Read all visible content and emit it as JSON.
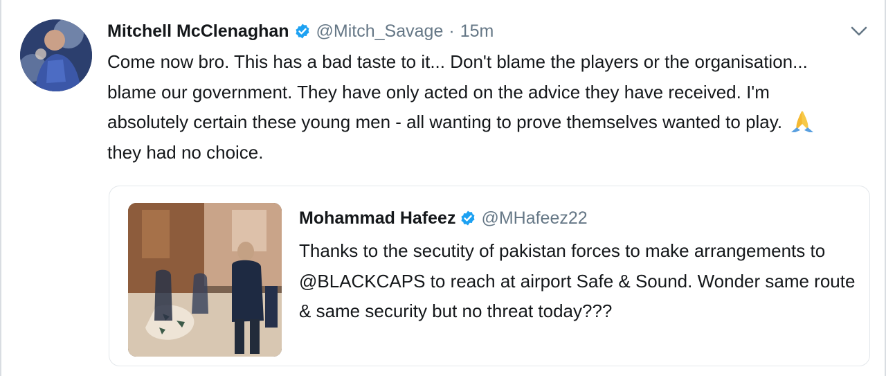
{
  "tweet": {
    "author_name": "Mitchell McClenaghan",
    "author_handle": "@Mitch_Savage",
    "separator": "·",
    "timestamp": "15m",
    "text_before_emoji": "Come now bro. This has a bad taste to it... Don't blame the players or the organisation... blame our government. They have only acted on the advice they have received. I'm absolutely certain these young men - all wanting to prove themselves  wanted to play.",
    "emoji_icon": "folded-hands-emoji",
    "text_after_emoji": " they had no choice.",
    "menu_icon": "chevron-down-icon"
  },
  "quoted_tweet": {
    "author_name": "Mohammad Hafeez",
    "author_handle": "@MHafeez22",
    "text": "Thanks to the secutity of pakistan forces to make arrangements to @BLACKCAPS to reach at airport Safe & Sound. Wonder same route & same security but no threat today???",
    "media_icon": "photo-thumbnail"
  },
  "colors": {
    "verified_blue": "#1da1f2",
    "muted_text": "#657786",
    "primary_text": "#14171a",
    "border": "#e3e7eb"
  }
}
